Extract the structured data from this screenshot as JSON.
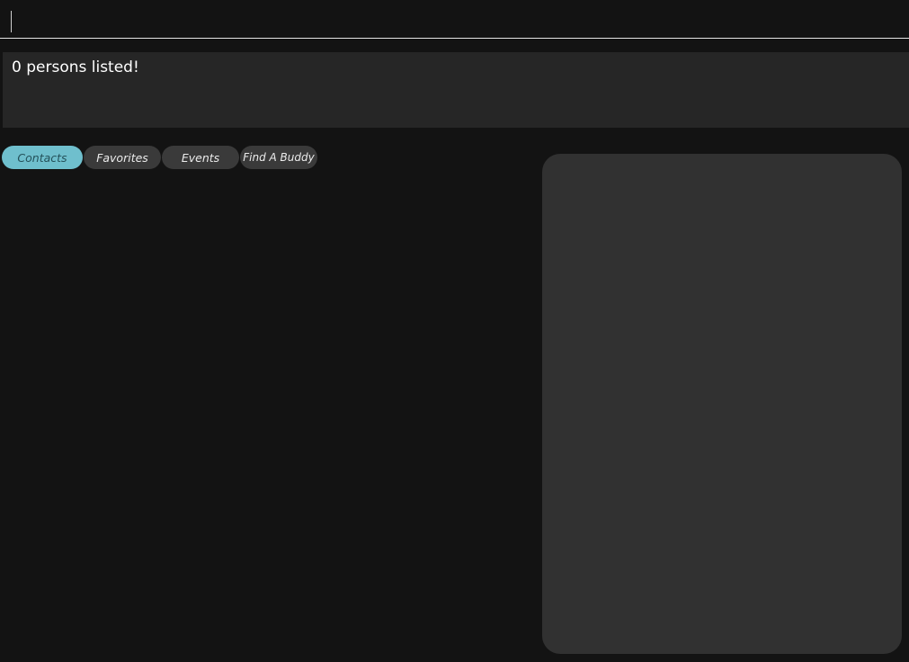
{
  "command_box": {
    "value": "",
    "placeholder": ""
  },
  "result_display": {
    "text": "0 persons listed!"
  },
  "tabs": [
    {
      "label": "Contacts",
      "active": true
    },
    {
      "label": "Favorites",
      "active": false
    },
    {
      "label": "Events",
      "active": false
    },
    {
      "label": "Find A Buddy",
      "active": false
    }
  ],
  "colors": {
    "background": "#131313",
    "panel": "#262626",
    "detail_panel": "#313131",
    "tab_active": "#6fbfcd",
    "tab_inactive": "#3a3a3a"
  }
}
